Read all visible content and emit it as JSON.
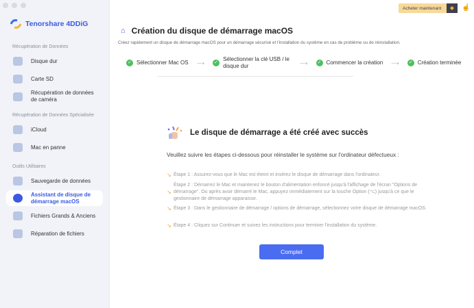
{
  "app": {
    "name": "Tenorshare 4DDiG"
  },
  "sidebar": {
    "sections": [
      {
        "label": "Récupération de Données",
        "items": [
          {
            "label": "Disque dur",
            "icon": "hard-drive-icon"
          },
          {
            "label": "Carte SD",
            "icon": "sd-card-icon"
          },
          {
            "label": "Récupération de données de caméra",
            "icon": "camera-icon"
          }
        ]
      },
      {
        "label": "Récupération de Données Spécialisée",
        "items": [
          {
            "label": "iCloud",
            "icon": "cloud-icon"
          },
          {
            "label": "Mac en panne",
            "icon": "crashed-mac-icon"
          }
        ]
      },
      {
        "label": "Outils Utilitaires",
        "items": [
          {
            "label": "Sauvegarde de données",
            "icon": "backup-icon"
          },
          {
            "label": "Assistant de disque de démarrage macOS",
            "icon": "apple-icon",
            "active": true
          },
          {
            "label": "Fichiers Grands & Anciens",
            "icon": "file-icon"
          },
          {
            "label": "Réparation de fichiers",
            "icon": "repair-icon"
          }
        ]
      }
    ]
  },
  "header": {
    "buy_label": "Acheter maintenant"
  },
  "main": {
    "title": "Création du disque de démarrage macOS",
    "subtitle": "Créez rapidement un disque de démarrage macOS pour un démarrage sécurisé et l'installation du système en cas de problème ou de réinstallation.",
    "steps": [
      "Sélectionner Mac OS",
      "Sélectionner la clé USB / le disque dur",
      "Commencer la création",
      "Création terminée"
    ],
    "success_title": "Le disque de démarrage a été créé avec succès",
    "intro": "Veuillez suivre les étapes ci-dessous pour réinstaller le système sur l'ordinateur défectueux :",
    "instructions": [
      "Étape 1 : Assurez-vous que le Mac est éteint et insérez le disque de démarrage dans l'ordinateur.",
      "Étape 2 : Démarrez le Mac et maintenez le bouton d'alimentation enfoncé jusqu'à l'affichage de l'écran \"Options de démarrage\". Ou après avoir démarré le Mac, appuyez immédiatement sur la touche Option (⌥) jusqu'à ce que le gestionnaire de démarrage apparaisse.",
      "Étape 3 : Dans le gestionnaire de démarrage / options de démarrage, sélectionnez votre disque de démarrage macOS.",
      "Étape 4 : Cliquez sur Continuer et suivez les instructions pour terminer l'installation du système."
    ],
    "complete_label": "Complet"
  },
  "colors": {
    "accent": "#3a5ae0",
    "success": "#4cc05e",
    "button": "#4a6cf0"
  }
}
